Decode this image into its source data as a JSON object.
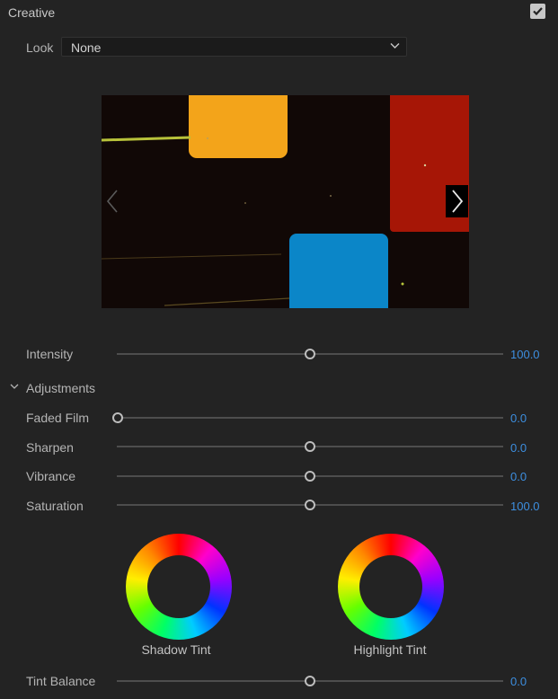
{
  "section": {
    "title": "Creative",
    "enabled": true
  },
  "look": {
    "label": "Look",
    "value": "None"
  },
  "preview": {
    "prev_icon": "chevron-left-icon",
    "next_icon": "chevron-right-icon",
    "colors": {
      "yellow": "#f3a41a",
      "red": "#a61606",
      "blue": "#0b86c8",
      "background": "#110806"
    }
  },
  "intensity": {
    "label": "Intensity",
    "value": "100.0",
    "position": 0.5
  },
  "adjustments": {
    "label": "Adjustments",
    "sliders": [
      {
        "label": "Faded Film",
        "value": "0.0",
        "position": 0.0
      },
      {
        "label": "Sharpen",
        "value": "0.0",
        "position": 0.5
      },
      {
        "label": "Vibrance",
        "value": "0.0",
        "position": 0.5
      },
      {
        "label": "Saturation",
        "value": "100.0",
        "position": 0.5
      }
    ]
  },
  "tints": {
    "shadow_label": "Shadow Tint",
    "highlight_label": "Highlight Tint"
  },
  "tint_balance": {
    "label": "Tint Balance",
    "value": "0.0",
    "position": 0.5
  },
  "colors": {
    "accent": "#3d8fe0",
    "panel": "#232323",
    "text": "#b4b4b4"
  }
}
